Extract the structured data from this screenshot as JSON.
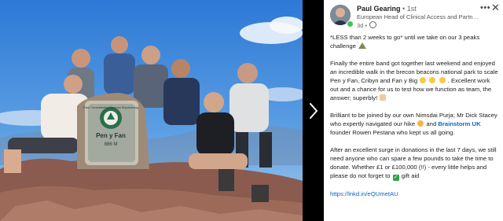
{
  "post": {
    "author_name": "Paul Gearing",
    "connection_degree": "• 1st",
    "headline": "European Head of Clinical Access and Partner...",
    "time": "3d •",
    "body": {
      "p1a": "*LESS than 2 weeks to go* until we take on our 3 peaks challenge",
      "p2a": "Finally the entire band got together last weekend and enjoyed an incredible walk in the brecon beacons national park to scale Pen y Fan, Cribyn and Fan y Big",
      "p2b": ". Excellent work out and a chance for us to test how we function as team, the answer; superbly!",
      "p3a": "Brilliant to be joined by our own Nimsdai Purja; Mr Dick Stacey who expertly navigated our hike",
      "p3b": "and",
      "p3_link": "Brainstorm UK",
      "p3c": "founder Rowen Pestana who kept us all going.",
      "p4a": "After an excellent surge in donations in the last 7 days, we still need anyone who can spare a few pounds to take the time to donate. Whether £1 or £100,000 (!!) - every little helps and please do not forget to",
      "p4b": "gift aid",
      "url": "https://lnkd.in/eQUmetAU"
    }
  },
  "photo": {
    "cairn_sign_top": "Parc Cenedlaethol Bannau Brycheiniog",
    "cairn_sign_name": "Pen y Fan",
    "cairn_sign_height": "886 M"
  },
  "icons": {
    "more": "more-options-icon",
    "close": "close-icon",
    "next": "chevron-right-icon"
  },
  "colors": {
    "link": "#0a66c2",
    "status_online": "#44c25a"
  }
}
